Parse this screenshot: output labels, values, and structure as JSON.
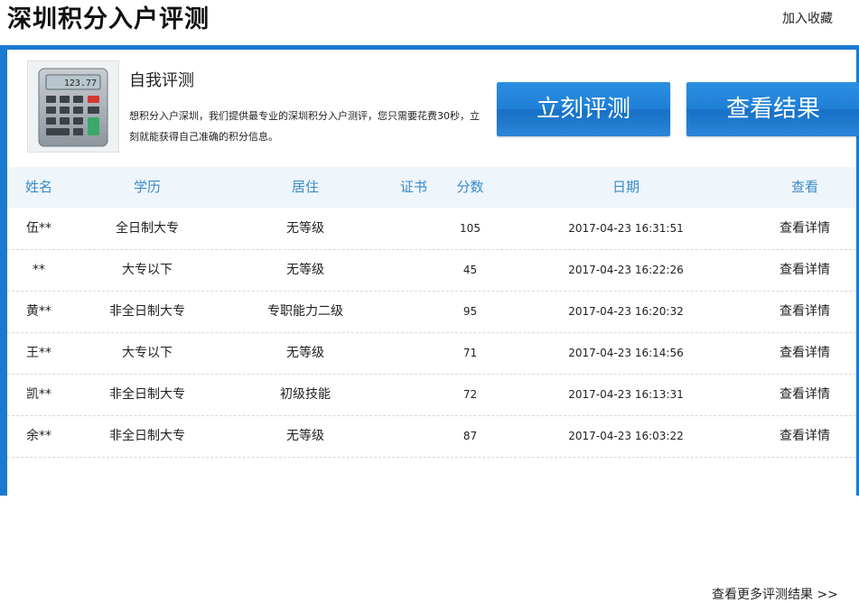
{
  "header": {
    "title": "深圳积分入户评测",
    "favorite_link": "加入收藏"
  },
  "promo": {
    "icon": "calculator-icon",
    "calc_display": "123.77",
    "title": "自我评测",
    "description": "想积分入户深圳，我们提供最专业的深圳积分入户测评，您只需要花费30秒，立刻就能获得自己准确的积分信息。",
    "button_start": "立刻评测",
    "button_view": "查看结果"
  },
  "table": {
    "headers": {
      "name": "姓名",
      "education": "学历",
      "residence": "居住",
      "certificate": "证书",
      "score": "分数",
      "date": "日期",
      "view": "查看"
    },
    "rows": [
      {
        "name": "伍**",
        "education": "全日制大专",
        "residence": "无等级",
        "certificate": "",
        "score": "105",
        "date": "2017-04-23 16:31:51",
        "view": "查看详情"
      },
      {
        "name": "**",
        "education": "大专以下",
        "residence": "无等级",
        "certificate": "",
        "score": "45",
        "date": "2017-04-23 16:22:26",
        "view": "查看详情"
      },
      {
        "name": "黄**",
        "education": "非全日制大专",
        "residence": "专职能力二级",
        "certificate": "",
        "score": "95",
        "date": "2017-04-23 16:20:32",
        "view": "查看详情"
      },
      {
        "name": "王**",
        "education": "大专以下",
        "residence": "无等级",
        "certificate": "",
        "score": "71",
        "date": "2017-04-23 16:14:56",
        "view": "查看详情"
      },
      {
        "name": "凯**",
        "education": "非全日制大专",
        "residence": "初级技能",
        "certificate": "",
        "score": "72",
        "date": "2017-04-23 16:13:31",
        "view": "查看详情"
      },
      {
        "name": "余**",
        "education": "非全日制大专",
        "residence": "无等级",
        "certificate": "",
        "score": "87",
        "date": "2017-04-23 16:03:22",
        "view": "查看详情"
      }
    ],
    "more_link": "查看更多评测结果 >>"
  },
  "colors": {
    "accent_blue": "#1a7ad0",
    "header_text": "#3a8ac6",
    "table_header_bg": "#eef5fb"
  }
}
